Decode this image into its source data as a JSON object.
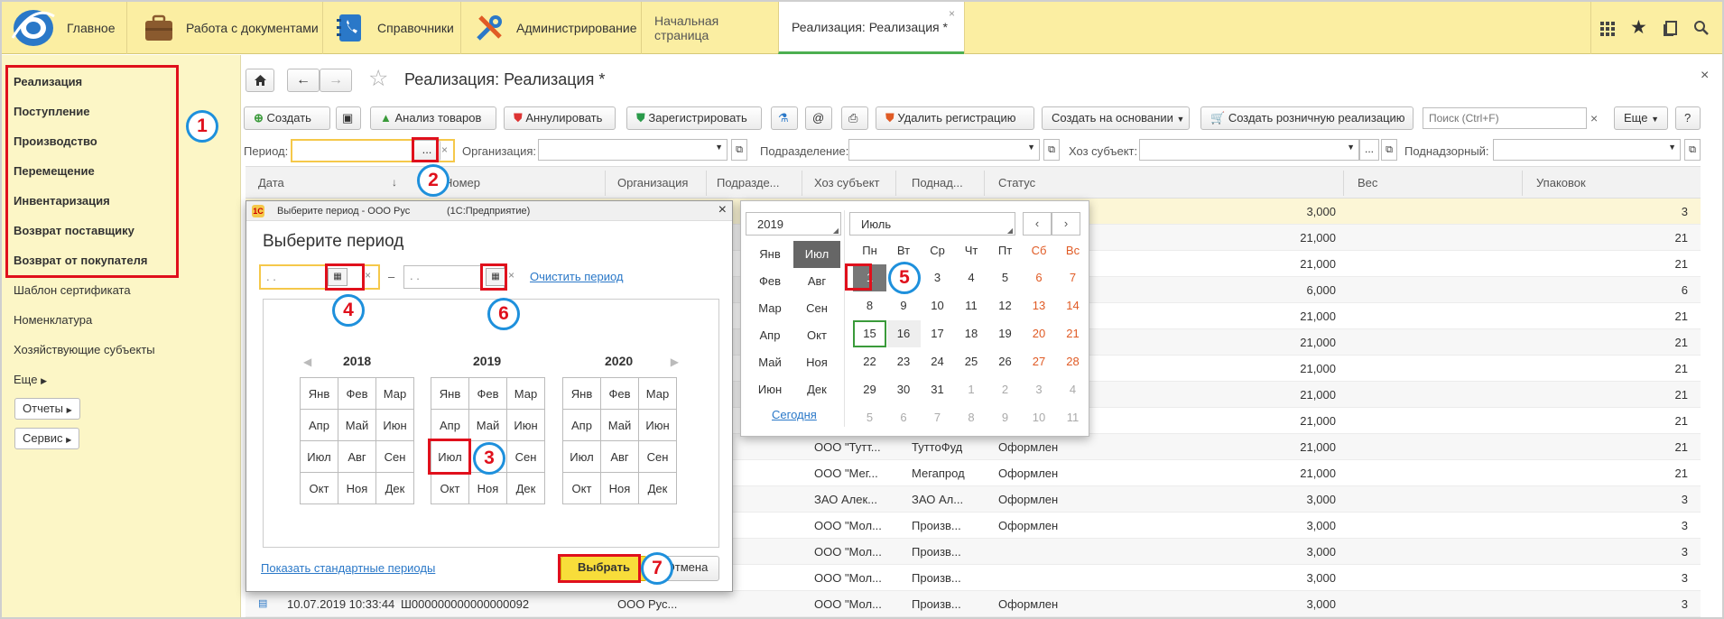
{
  "topbar": {
    "sections": [
      {
        "label": "Главное",
        "icon": "logo-icon"
      },
      {
        "label": "Работа с документами",
        "icon": "briefcase-icon"
      },
      {
        "label": "Справочники",
        "icon": "phonebook-icon"
      },
      {
        "label": "Администрирование",
        "icon": "tools-icon"
      }
    ],
    "tabs": [
      {
        "label": "Начальная страница"
      },
      {
        "label": "Реализация: Реализация *"
      }
    ],
    "icons": [
      "apps-icon",
      "star-icon",
      "history-icon",
      "search-icon"
    ]
  },
  "sidebar": {
    "bold_items": [
      "Реализация",
      "Поступление",
      "Производство",
      "Перемещение",
      "Инвентаризация",
      "Возврат поставщику",
      "Возврат от покупателя"
    ],
    "items": [
      "Шаблон сертификата",
      "Номенклатура",
      "Хозяйствующие субъекты",
      "Еще"
    ],
    "buttons": [
      "Отчеты",
      "Сервис"
    ]
  },
  "page": {
    "title": "Реализация: Реализация *"
  },
  "toolbar": {
    "create": "Создать",
    "analysis": "Анализ товаров",
    "annul": "Аннулировать",
    "register": "Зарегистрировать",
    "at": "@",
    "delete_reg": "Удалить регистрацию",
    "create_base": "Создать на основании",
    "create_retail": "Создать розничную реализацию",
    "search_placeholder": "Поиск (Ctrl+F)",
    "more": "Еще",
    "help": "?"
  },
  "filters": {
    "period": "Период:",
    "period_btn": "...",
    "org": "Организация:",
    "dept": "Подразделение:",
    "subject": "Хоз субъект:",
    "subject_btn": "...",
    "supervised": "Поднадзорный:"
  },
  "table": {
    "headers": [
      "Дата",
      "Номер",
      "Организация",
      "Подразде...",
      "Хоз субъект",
      "Поднад...",
      "Статус",
      "Вес",
      "Упаковок"
    ],
    "rows": [
      {
        "org": "",
        "dept": "",
        "subj": "",
        "sup": "",
        "status": "",
        "weight": "3,000",
        "packs": "3"
      },
      {
        "org": "",
        "dept": "",
        "subj": "",
        "sup": "",
        "status": "",
        "weight": "21,000",
        "packs": "21"
      },
      {
        "org": "",
        "dept": "",
        "subj": "",
        "sup": "",
        "status": "",
        "weight": "21,000",
        "packs": "21"
      },
      {
        "org": "",
        "dept": "",
        "subj": "",
        "sup": "",
        "status": "",
        "weight": "6,000",
        "packs": "6"
      },
      {
        "org": "",
        "dept": "",
        "subj": "",
        "sup": "",
        "status": "",
        "weight": "21,000",
        "packs": "21"
      },
      {
        "org": "",
        "dept": "",
        "subj": "",
        "sup": "",
        "status": "",
        "weight": "21,000",
        "packs": "21"
      },
      {
        "org": "",
        "dept": "",
        "subj": "",
        "sup": "",
        "status": "",
        "weight": "21,000",
        "packs": "21"
      },
      {
        "org": "",
        "dept": "",
        "subj": "",
        "sup": "",
        "status": "",
        "weight": "21,000",
        "packs": "21"
      },
      {
        "org": "",
        "dept": "",
        "subj": "",
        "sup": "",
        "status": "",
        "weight": "21,000",
        "packs": "21"
      },
      {
        "org": "О Рус...",
        "dept": "",
        "subj": "ООО \"Тутт...",
        "sup": "ТуттоФуд",
        "status": "Оформлен",
        "weight": "21,000",
        "packs": "21"
      },
      {
        "org": "О Рус...",
        "dept": "",
        "subj": "ООО \"Мег...",
        "sup": "Мегапрод",
        "status": "Оформлен",
        "weight": "21,000",
        "packs": "21"
      },
      {
        "org": "О Рус...",
        "dept": "",
        "subj": "ЗАО Алек...",
        "sup": "ЗАО Ал...",
        "status": "Оформлен",
        "weight": "3,000",
        "packs": "3"
      },
      {
        "org": "О Рус...",
        "dept": "",
        "subj": "ООО \"Мол...",
        "sup": "Произв...",
        "status": "Оформлен",
        "weight": "3,000",
        "packs": "3"
      },
      {
        "org": "О Рус...",
        "dept": "",
        "subj": "ООО \"Мол...",
        "sup": "Произв...",
        "status": "",
        "weight": "3,000",
        "packs": "3"
      },
      {
        "org": "О Рус...",
        "dept": "",
        "subj": "ООО \"Мол...",
        "sup": "Произв...",
        "status": "",
        "weight": "3,000",
        "packs": "3"
      },
      {
        "date": "10.07.2019 10:33:44",
        "num": "Ш000000000000000092",
        "org": "ООО Рус...",
        "dept": "",
        "subj": "ООО \"Мол...",
        "sup": "Произв...",
        "status": "Оформлен",
        "weight": "3,000",
        "packs": "3"
      }
    ]
  },
  "dialog": {
    "window_title": "Выберите период - ООО Рус",
    "app": "(1С:Предприятие)",
    "heading": "Выберите период",
    "date_from": ". .",
    "dash": "–",
    "date_to": ". .",
    "clear": "Очистить период",
    "years": [
      "2018",
      "2019",
      "2020"
    ],
    "months": [
      [
        "Янв",
        "Фев",
        "Мар"
      ],
      [
        "Апр",
        "Май",
        "Июн"
      ],
      [
        "Июл",
        "Авг",
        "Сен"
      ],
      [
        "Окт",
        "Ноя",
        "Дек"
      ]
    ],
    "show_std": "Показать стандартные периоды",
    "choose": "Выбрать",
    "cancel": "Отмена"
  },
  "calendar": {
    "year": "2019",
    "month_name": "Июль",
    "months": [
      [
        "Янв",
        "Июл"
      ],
      [
        "Фев",
        "Авг"
      ],
      [
        "Мар",
        "Сен"
      ],
      [
        "Апр",
        "Окт"
      ],
      [
        "Май",
        "Ноя"
      ],
      [
        "Июн",
        "Дек"
      ]
    ],
    "today": "Сегодня",
    "weekdays": [
      "Пн",
      "Вт",
      "Ср",
      "Чт",
      "Пт",
      "Сб",
      "Вс"
    ],
    "weeks": [
      [
        "1",
        "2",
        "3",
        "4",
        "5",
        "6",
        "7"
      ],
      [
        "8",
        "9",
        "10",
        "11",
        "12",
        "13",
        "14"
      ],
      [
        "15",
        "16",
        "17",
        "18",
        "19",
        "20",
        "21"
      ],
      [
        "22",
        "23",
        "24",
        "25",
        "26",
        "27",
        "28"
      ],
      [
        "29",
        "30",
        "31",
        "1",
        "2",
        "3",
        "4"
      ],
      [
        "5",
        "6",
        "7",
        "8",
        "9",
        "10",
        "11"
      ]
    ]
  },
  "callouts": [
    "1",
    "2",
    "3",
    "4",
    "5",
    "6",
    "7"
  ]
}
